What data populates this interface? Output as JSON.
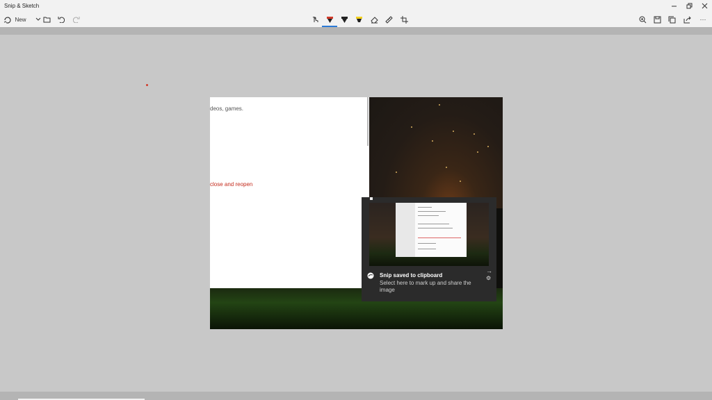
{
  "window": {
    "title": "Snip & Sketch",
    "controls": [
      "minimize",
      "restore",
      "close"
    ]
  },
  "toolbar": {
    "new_label": "New",
    "left_icons": [
      "new-snip-icon",
      "chevron-down-icon",
      "open-folder-icon",
      "undo-icon",
      "redo-icon"
    ],
    "tools": [
      "touch-writing-icon",
      "ballpoint-pen-icon",
      "pencil-icon",
      "highlighter-icon",
      "eraser-icon",
      "ruler-icon",
      "crop-icon"
    ],
    "active_tool": "ballpoint-pen",
    "right_icons": [
      "zoom-icon",
      "save-icon",
      "copy-icon",
      "share-icon",
      "more-icon"
    ]
  },
  "snip_content": {
    "text_line1": "deos, games.",
    "text_line2": "close and reopen"
  },
  "toast": {
    "title": "Snip saved to clipboard",
    "body": "Select here to mark up and share the image"
  },
  "colors": {
    "accent": "#2b79d6",
    "pen_red": "#d13b2b",
    "highlighter": "#f2d01e",
    "toast_bg": "#2b2b2b"
  }
}
